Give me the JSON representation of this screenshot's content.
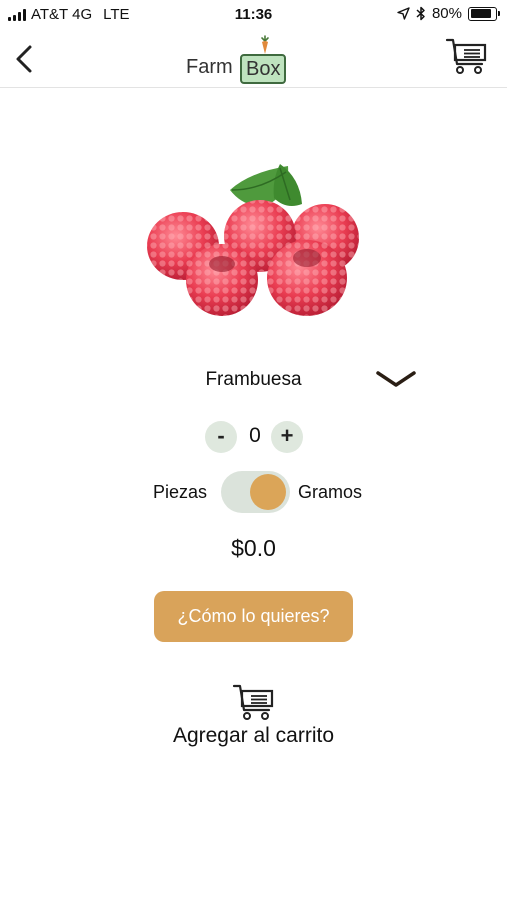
{
  "status_bar": {
    "carrier": "AT&T 4G",
    "network": "LTE",
    "time": "11:36",
    "battery": "80%",
    "battery_level": 0.8
  },
  "header": {
    "logo_word1": "Farm",
    "logo_word2": "Box",
    "icons": [
      "chevron-left-icon",
      "cart-icon"
    ]
  },
  "product": {
    "name": "Frambuesa",
    "image": "raspberries",
    "quantity": "0",
    "minus_label": "-",
    "plus_label": "+",
    "unit_left": "Piezas",
    "unit_right": "Gramos",
    "unit_selected": "Gramos",
    "price": "$0.0"
  },
  "actions": {
    "how_label": "¿Cómo lo quieres?",
    "add_to_cart_label": "Agregar al carrito"
  },
  "colors": {
    "accent": "#d9a35a",
    "stepper_bg": "#dfe8de",
    "toggle_bg": "#dbe3db",
    "logo_box_fill": "#bfe3bf"
  }
}
